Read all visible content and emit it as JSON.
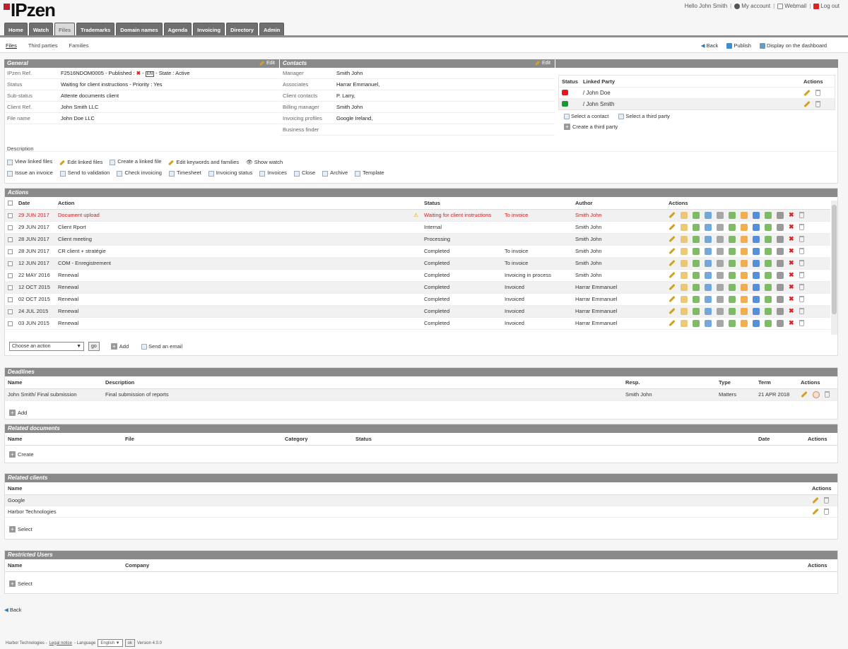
{
  "app": {
    "logo": "IPzen"
  },
  "toplinks": {
    "greeting": "Hello John Smith",
    "account": "My account",
    "webmail": "Webmail",
    "logout": "Log out",
    "sep": "|"
  },
  "tabs": [
    "Home",
    "Watch",
    "Files",
    "Trademarks",
    "Domain names",
    "Agenda",
    "Invoicing",
    "Directory",
    "Admin"
  ],
  "active_tab": "Files",
  "subtabs": [
    "Files",
    "Third parties",
    "Families"
  ],
  "rightlinks": {
    "back": "Back",
    "publish": "Publish",
    "dashboard": "Display on the dashboard"
  },
  "general": {
    "title": "General",
    "edit": "Edit",
    "rows": [
      {
        "k": "IPzen Ref.",
        "v": "F2516NDOM0005 - Published :",
        "v2": "- State : Active",
        "badge": "EN"
      },
      {
        "k": "Status",
        "v": "Waiting for client instructions - Priority : Yes"
      },
      {
        "k": "Sub-status",
        "v": "Attente documents client"
      },
      {
        "k": "Client Ref.",
        "v": "John Smith LLC"
      },
      {
        "k": "File name",
        "v": "John Doe LLC"
      }
    ]
  },
  "contacts": {
    "title": "Contacts",
    "edit": "Edit",
    "rows": [
      {
        "k": "Manager",
        "v": "Smith John"
      },
      {
        "k": "Associates",
        "v": "Harrar Emmanuel,"
      },
      {
        "k": "Client contacts",
        "v": "P. Larry,"
      },
      {
        "k": "Billing manager",
        "v": "Smith John"
      },
      {
        "k": "Invoicing profiles",
        "v": "Google Ireland,"
      },
      {
        "k": "Business finder",
        "v": ""
      }
    ]
  },
  "parties": {
    "headers": [
      "Status",
      "Linked Party",
      "Actions"
    ],
    "rows": [
      {
        "color": "#e31b1b",
        "name": "/ John Doe"
      },
      {
        "color": "#1a9a2a",
        "name": "/ John Smith"
      }
    ],
    "links": [
      "Select a contact",
      "Select a third party",
      "Create a third party"
    ]
  },
  "description_label": "Description",
  "file_links_1": [
    "View linked files",
    "Edit linked files",
    "Create a linked file",
    "Edit keywords and families",
    "Show watch"
  ],
  "file_links_2": [
    "Issue an invoice",
    "Send to validation",
    "Check invoicing",
    "Timesheet",
    "Invoicing status",
    "Invoices",
    "Close",
    "Archive",
    "Template"
  ],
  "actions": {
    "title": "Actions",
    "headers": [
      "Date",
      "Action",
      "Status",
      "",
      "Author",
      "Actions"
    ],
    "rows": [
      {
        "date": "29 JUN 2017",
        "action": "Document upload",
        "status": "Waiting for client instructions",
        "status2": "To invoice",
        "author": "Smith John",
        "red": true,
        "warn": true
      },
      {
        "date": "29 JUN 2017",
        "action": "Client Rport",
        "status": "Internal",
        "status2": "",
        "author": "Smith John"
      },
      {
        "date": "28 JUN 2017",
        "action": "Client meeting",
        "status": "Processing",
        "status2": "",
        "author": "Smith John"
      },
      {
        "date": "28 JUN 2017",
        "action": "CR client + stratégie",
        "status": "Completed",
        "status2": "To invoice",
        "author": "Smith John"
      },
      {
        "date": "12 JUN 2017",
        "action": "COM - Enregistrement",
        "status": "Completed",
        "status2": "To invoice",
        "author": "Smith John"
      },
      {
        "date": "22 MAY 2016",
        "action": "Renewal",
        "status": "Completed",
        "status2": "Invoicing in process",
        "author": "Smith John"
      },
      {
        "date": "12 OCT 2015",
        "action": "Renewal",
        "status": "Completed",
        "status2": "Invoiced",
        "author": "Harrar Emmanuel"
      },
      {
        "date": "02 OCT 2015",
        "action": "Renewal",
        "status": "Completed",
        "status2": "Invoiced",
        "author": "Harrar Emmanuel"
      },
      {
        "date": "24 JUL 2015",
        "action": "Renewal",
        "status": "Completed",
        "status2": "Invoiced",
        "author": "Harrar Emmanuel"
      },
      {
        "date": "03 JUN 2015",
        "action": "Renewal",
        "status": "Completed",
        "status2": "Invoiced",
        "author": "Harrar Emmanuel"
      }
    ],
    "choose": "Choose an action",
    "go": "go",
    "add": "Add",
    "email": "Send an email"
  },
  "deadlines": {
    "title": "Deadlines",
    "headers": [
      "Name",
      "Description",
      "Resp.",
      "Type",
      "Term",
      "Actions"
    ],
    "row": {
      "name": "John Smith/ Final submission",
      "desc": "Final submission of reports",
      "resp": "Smith John",
      "type": "Matters",
      "term": "21 APR 2018"
    },
    "add": "Add"
  },
  "documents": {
    "title": "Related documents",
    "headers": [
      "Name",
      "File",
      "Category",
      "Status",
      "Date",
      "Actions"
    ],
    "create": "Create"
  },
  "clients": {
    "title": "Related clients",
    "headers": [
      "Name",
      "Actions"
    ],
    "rows": [
      "Google",
      "Harbor Technologies"
    ],
    "select": "Select"
  },
  "restricted": {
    "title": "Restricted Users",
    "headers": [
      "Name",
      "Company",
      "Actions"
    ],
    "select": "Select"
  },
  "back": "Back",
  "footer": {
    "company": "Harbor Technologies -",
    "legal": "Legal notice",
    "language": "- Language",
    "lang_value": "English",
    "ok": "ok",
    "version": "Version 4.0.0"
  }
}
